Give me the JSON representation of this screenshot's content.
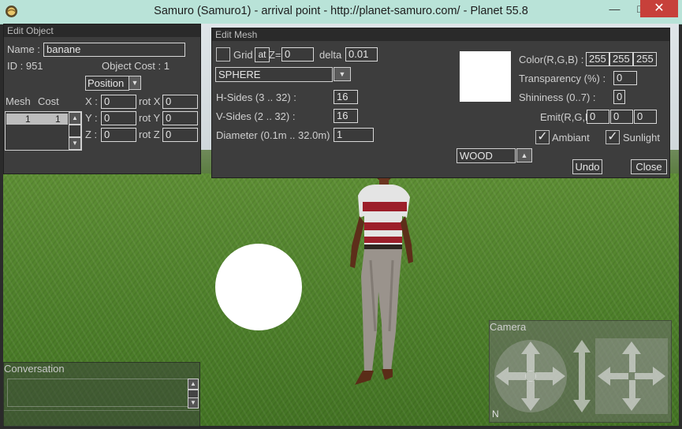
{
  "window": {
    "title": "Samuro (Samuro1) - arrival point - http://planet-samuro.com/ - Planet 55.8",
    "minimize_label": "—",
    "maximize_label": "□",
    "close_label": "✕",
    "app_icon": "planet-icon"
  },
  "edit_object": {
    "title": "Edit Object",
    "name_label": "Name :",
    "name_value": "banane",
    "id_text": "ID : 951",
    "cost_text": "Object Cost : 1",
    "mode_value": "Position",
    "mesh_header": "Mesh",
    "cost_header": "Cost",
    "rows": [
      {
        "mesh": "1",
        "cost": "1"
      }
    ],
    "x_label": "X :",
    "y_label": "Y :",
    "z_label": "Z :",
    "x_value": "0",
    "y_value": "0",
    "z_value": "0",
    "rotx_label": "rot X",
    "roty_label": "rot Y",
    "rotz_label": "rot Z",
    "rotx_value": "0",
    "roty_value": "0",
    "rotz_value": "0"
  },
  "edit_mesh": {
    "title": "Edit Mesh",
    "grid_label": "Grid",
    "at_label": "at",
    "z_label": "Z=",
    "z_value": "0",
    "delta_label": "delta",
    "delta_value": "0.01",
    "shape_value": "SPHERE",
    "hsides_label": "H-Sides (3 .. 32) :",
    "hsides_value": "16",
    "vsides_label": "V-Sides (2 .. 32) :",
    "vsides_value": "16",
    "diameter_label": "Diameter (0.1m .. 32.0m) :",
    "diameter_value": "1",
    "color_label": "Color(R,G,B) :",
    "color_r": "255",
    "color_g": "255",
    "color_b": "255",
    "transparency_label": "Transparency (%) :",
    "transparency_value": "0",
    "shininess_label": "Shininess (0..7) :",
    "shininess_value": "0",
    "emit_label": "Emit(R,G,B) :",
    "emit_r": "0",
    "emit_g": "0",
    "emit_b": "0",
    "ambiant_label": "Ambiant",
    "sunlight_label": "Sunlight",
    "material_value": "WOOD",
    "undo_label": "Undo",
    "close_label": "Close",
    "swatch_color": "#ffffff"
  },
  "conversation": {
    "title": "Conversation"
  },
  "camera": {
    "title": "Camera",
    "north_label": "N"
  }
}
